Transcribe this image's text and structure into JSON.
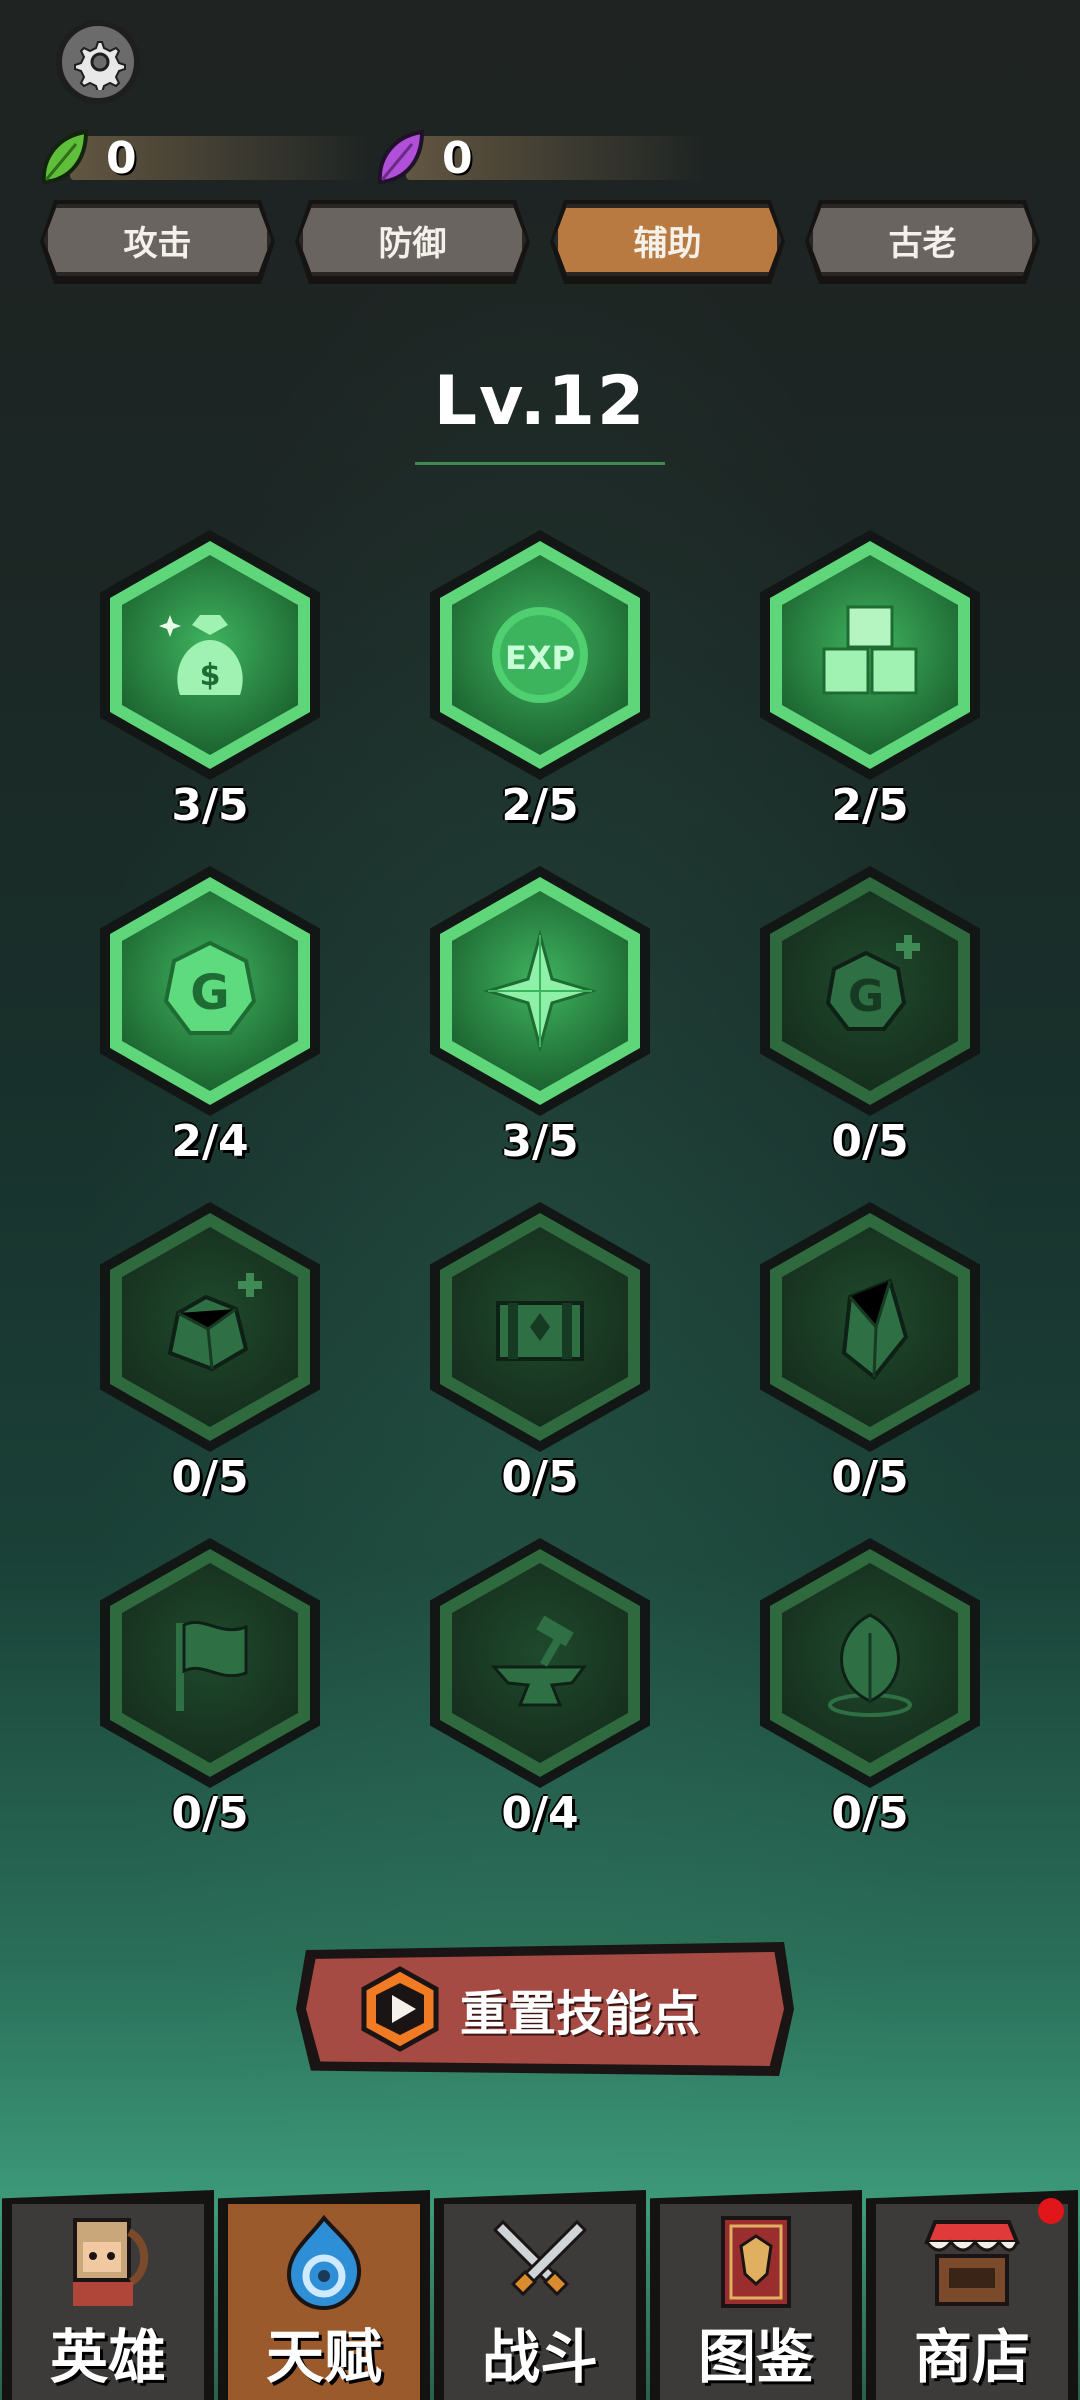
{
  "currencies": [
    {
      "icon": "green-leaf-icon",
      "value": "0",
      "color": "#5fbf3a"
    },
    {
      "icon": "purple-leaf-icon",
      "value": "0",
      "color": "#b04fd8"
    }
  ],
  "tabs": [
    {
      "label": "攻击",
      "active": false
    },
    {
      "label": "防御",
      "active": false
    },
    {
      "label": "辅助",
      "active": true
    },
    {
      "label": "古老",
      "active": false
    }
  ],
  "level": "Lv.12",
  "talents": [
    {
      "icon": "money-bag-icon",
      "count": "3/5",
      "unlocked": true
    },
    {
      "icon": "exp-coin-icon",
      "count": "2/5",
      "unlocked": true
    },
    {
      "icon": "crates-icon",
      "count": "2/5",
      "unlocked": true
    },
    {
      "icon": "gold-coin-icon",
      "count": "2/4",
      "unlocked": true
    },
    {
      "icon": "star-crystal-icon",
      "count": "3/5",
      "unlocked": true
    },
    {
      "icon": "gold-coin-plus-icon",
      "count": "0/5",
      "unlocked": false
    },
    {
      "icon": "ore-plus-icon",
      "count": "0/5",
      "unlocked": false
    },
    {
      "icon": "treasure-chest-icon",
      "count": "0/5",
      "unlocked": false
    },
    {
      "icon": "crystal-shard-icon",
      "count": "0/5",
      "unlocked": false
    },
    {
      "icon": "flag-icon",
      "count": "0/5",
      "unlocked": false
    },
    {
      "icon": "anvil-hammer-icon",
      "count": "0/4",
      "unlocked": false
    },
    {
      "icon": "leaf-icon",
      "count": "0/5",
      "unlocked": false
    }
  ],
  "reset_button": {
    "label": "重置技能点",
    "icon": "play-video-icon"
  },
  "nav": [
    {
      "label": "英雄",
      "icon": "hero-portrait-icon",
      "active": false,
      "badge": false
    },
    {
      "label": "天赋",
      "icon": "talent-swirl-icon",
      "active": true,
      "badge": false
    },
    {
      "label": "战斗",
      "icon": "crossed-swords-icon",
      "active": false,
      "badge": false
    },
    {
      "label": "图鉴",
      "icon": "codex-book-icon",
      "active": false,
      "badge": false
    },
    {
      "label": "商店",
      "icon": "shop-stall-icon",
      "active": false,
      "badge": true
    }
  ],
  "colors": {
    "accent_tab": "#b87a40",
    "reset_button": "#a64a44",
    "unlocked_border": "#5fd67a",
    "badge": "#e0161b"
  }
}
